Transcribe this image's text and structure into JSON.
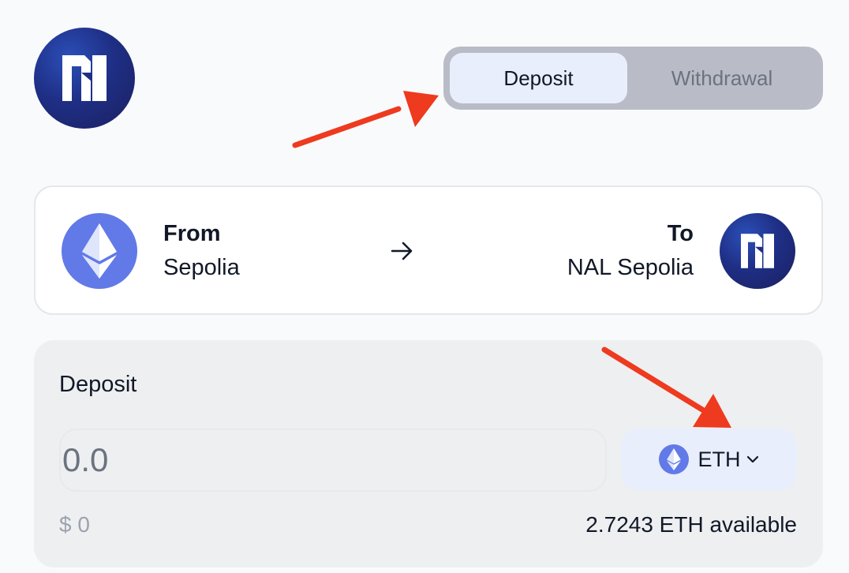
{
  "header": {
    "logo_icon": "nal-logo-icon"
  },
  "mode_toggle": {
    "deposit_label": "Deposit",
    "withdrawal_label": "Withdrawal",
    "selected": "Deposit"
  },
  "route": {
    "from_label": "From",
    "from_network": "Sepolia",
    "from_icon": "ethereum-icon",
    "arrow_icon": "arrow-right-icon",
    "to_label": "To",
    "to_network": "NAL Sepolia",
    "to_icon": "nal-logo-icon"
  },
  "deposit_panel": {
    "title": "Deposit",
    "amount_placeholder": "0.0",
    "amount_value": "",
    "token_symbol": "ETH",
    "token_icon": "ethereum-icon",
    "usd_value": "$ 0",
    "available": "2.7243 ETH available"
  },
  "colors": {
    "accent_light": "#e8eefb",
    "toggle_bg": "#b9bcc6",
    "ethereum": "#6279e8",
    "nal_dark": "#1f2f86",
    "annotation_arrow": "#ee3a1e"
  }
}
